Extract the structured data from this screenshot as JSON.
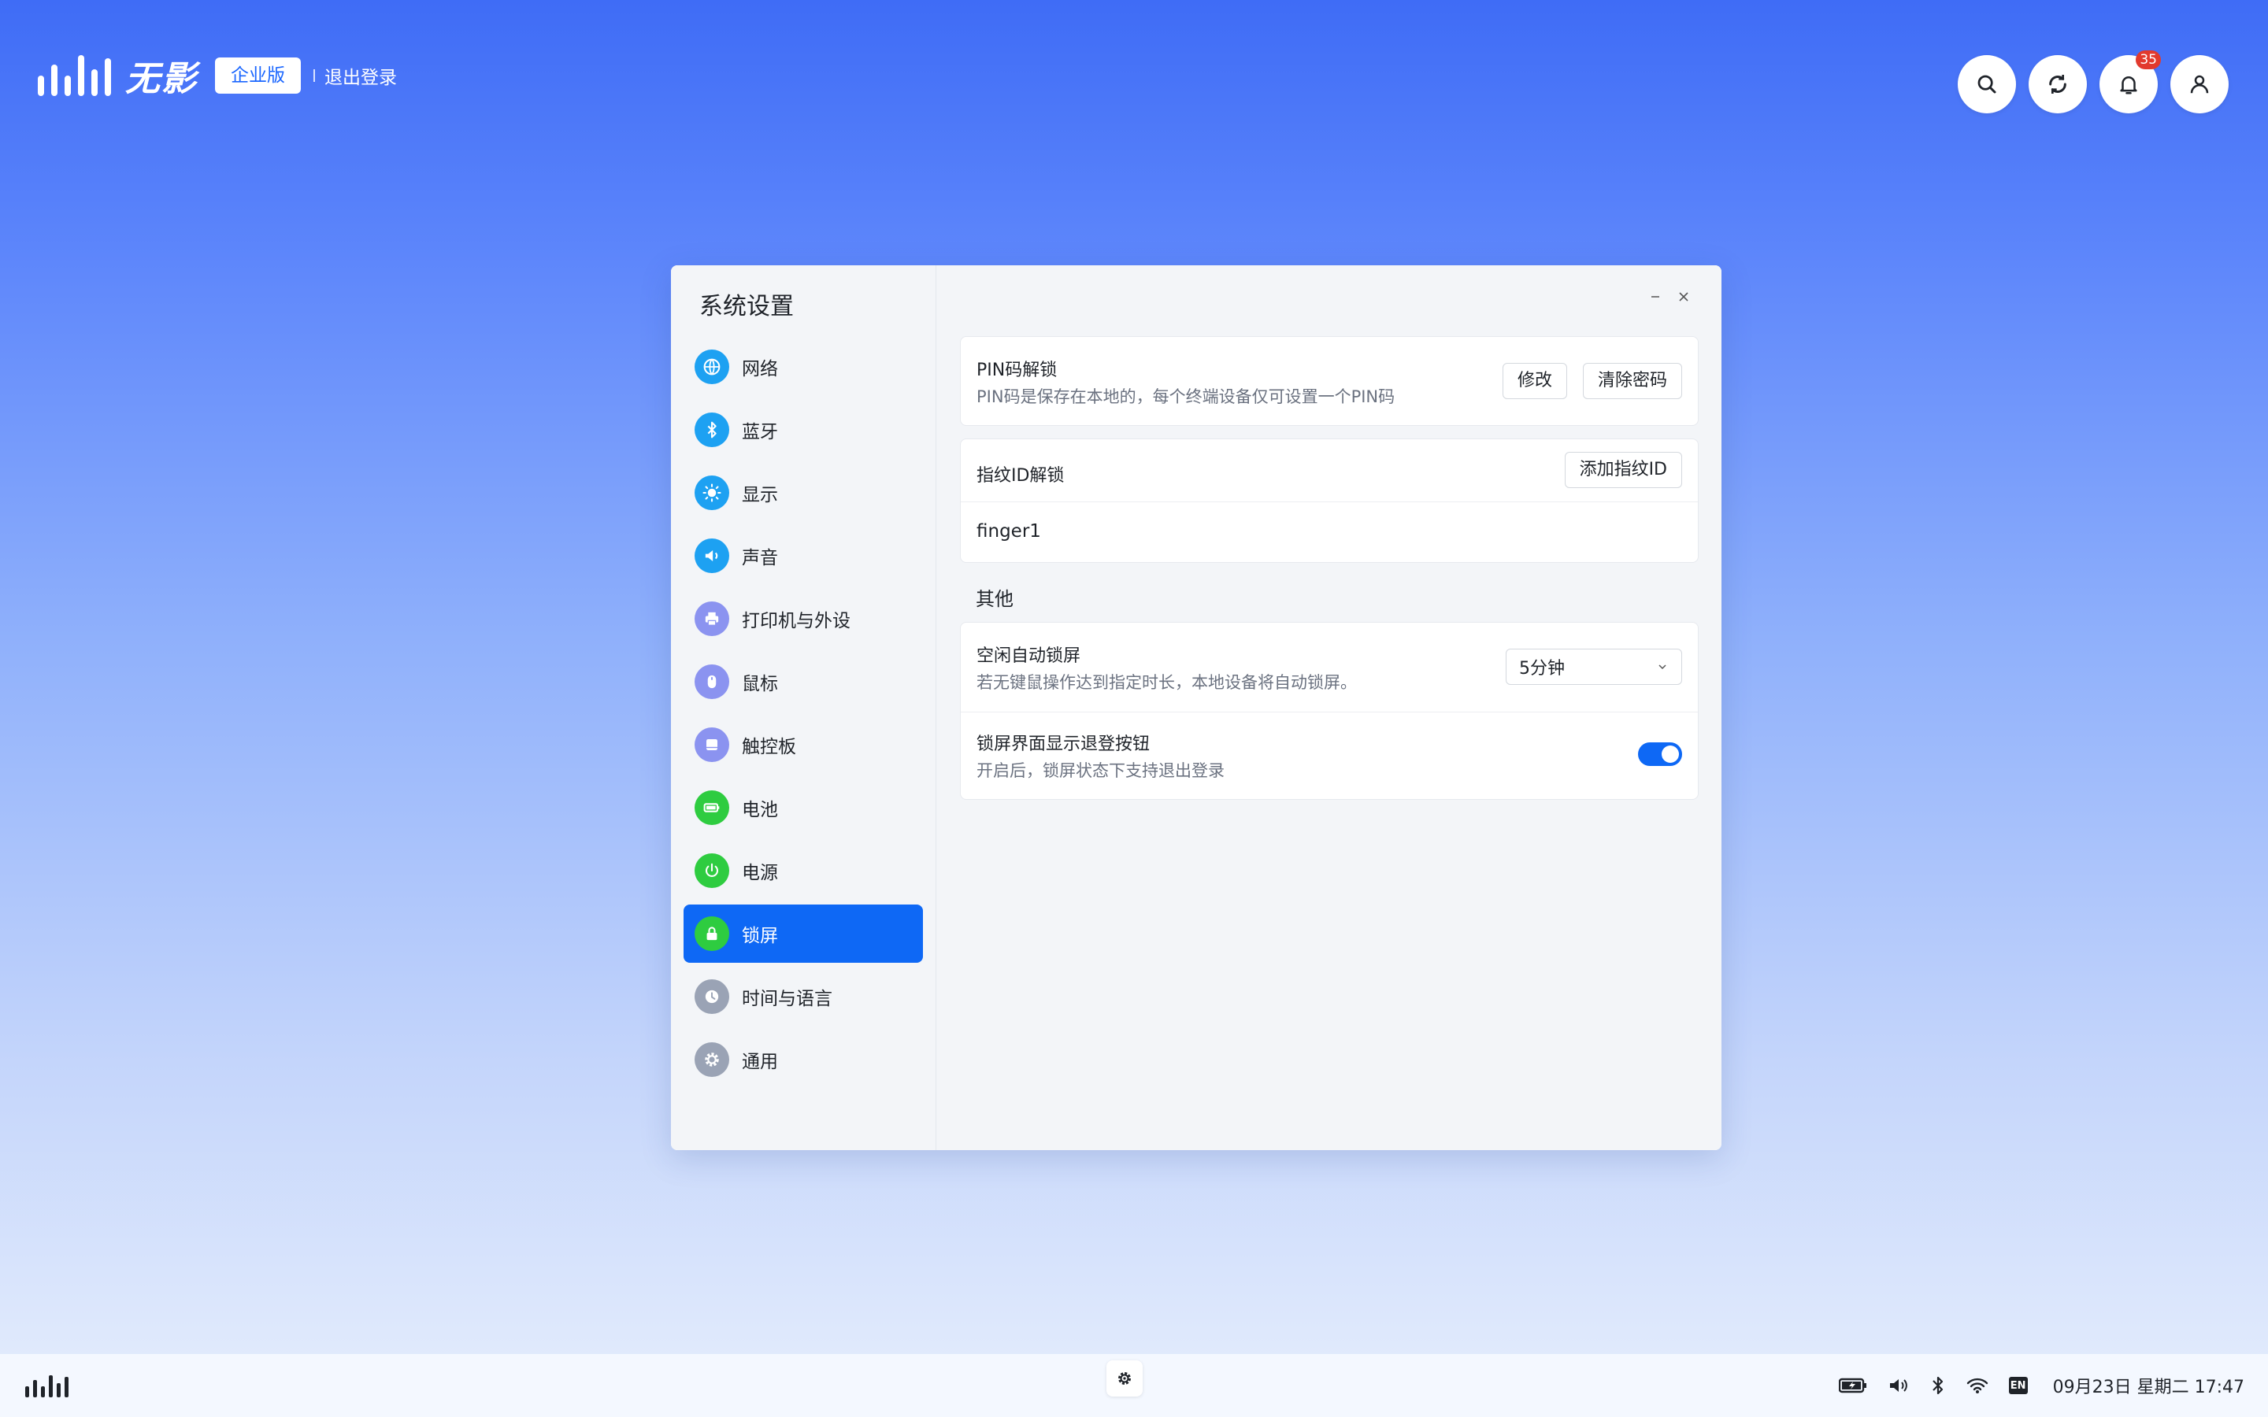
{
  "header": {
    "brand_name": "无影",
    "edition": "企业版",
    "logout": "退出登录",
    "icons": [
      "search-icon",
      "sync-icon",
      "bell-icon",
      "user-icon"
    ],
    "notification_count": "35"
  },
  "window": {
    "title": "系统设置",
    "menu": [
      {
        "label": "网络",
        "icon": "globe-icon",
        "color": "#1da1f2"
      },
      {
        "label": "蓝牙",
        "icon": "bluetooth-icon",
        "color": "#1da1f2"
      },
      {
        "label": "显示",
        "icon": "sun-icon",
        "color": "#1da1f2"
      },
      {
        "label": "声音",
        "icon": "speaker-icon",
        "color": "#1da1f2"
      },
      {
        "label": "打印机与外设",
        "icon": "printer-icon",
        "color": "#8b93f0"
      },
      {
        "label": "鼠标",
        "icon": "mouse-icon",
        "color": "#8b93f0"
      },
      {
        "label": "触控板",
        "icon": "touchpad-icon",
        "color": "#8b93f0"
      },
      {
        "label": "电池",
        "icon": "battery-icon",
        "color": "#2ecc40"
      },
      {
        "label": "电源",
        "icon": "power-icon",
        "color": "#2ecc40"
      },
      {
        "label": "锁屏",
        "icon": "lock-icon",
        "color": "#2ecc40",
        "active": true
      },
      {
        "label": "时间与语言",
        "icon": "clock-icon",
        "color": "#9aa3b5"
      },
      {
        "label": "通用",
        "icon": "gear-icon",
        "color": "#9aa3b5"
      }
    ],
    "pin": {
      "title": "PIN码解锁",
      "desc": "PIN码是保存在本地的，每个终端设备仅可设置一个PIN码",
      "modify": "修改",
      "clear": "清除密码"
    },
    "fingerprint": {
      "title": "指纹ID解锁",
      "add": "添加指纹ID",
      "entries": [
        "finger1"
      ]
    },
    "other": {
      "label": "其他",
      "idle_lock": {
        "title": "空闲自动锁屏",
        "desc": "若无键鼠操作达到指定时长，本地设备将自动锁屏。",
        "value": "5分钟"
      },
      "show_logout": {
        "title": "锁屏界面显示退登按钮",
        "desc": "开启后，锁屏状态下支持退出登录",
        "enabled": true
      }
    }
  },
  "taskbar": {
    "tray_icons": [
      "battery-charging-icon",
      "volume-icon",
      "bluetooth-icon",
      "wifi-icon",
      "input-method-icon"
    ],
    "input_method": "EN",
    "clock": "09月23日  星期二  17:47"
  }
}
